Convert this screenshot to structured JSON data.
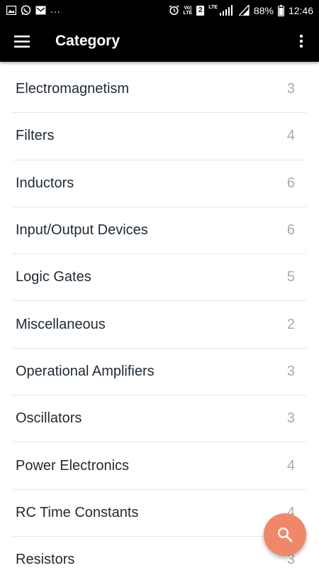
{
  "status_bar": {
    "left_icons": [
      "gallery-icon",
      "whatsapp-icon",
      "mail-icon"
    ],
    "overflow": "...",
    "vol_lte_top": "Vo)",
    "vol_lte_bottom": "LTE",
    "sim": "2",
    "lte": "LTE",
    "battery": "88%",
    "time": "12:46"
  },
  "app_bar": {
    "title": "Category",
    "menu_icon": "hamburger-menu-icon",
    "overflow_icon": "more-vert-icon"
  },
  "categories": [
    {
      "label": "Electromagnetism",
      "count": "3"
    },
    {
      "label": "Filters",
      "count": "4"
    },
    {
      "label": "Inductors",
      "count": "6"
    },
    {
      "label": "Input/Output Devices",
      "count": "6"
    },
    {
      "label": "Logic Gates",
      "count": "5"
    },
    {
      "label": "Miscellaneous",
      "count": "2"
    },
    {
      "label": "Operational Amplifiers",
      "count": "3"
    },
    {
      "label": "Oscillators",
      "count": "3"
    },
    {
      "label": "Power Electronics",
      "count": "4"
    },
    {
      "label": "RC Time Constants",
      "count": "4"
    },
    {
      "label": "Resistors",
      "count": "3"
    }
  ],
  "fab": {
    "icon": "search-icon",
    "color": "#f0876a"
  },
  "colors": {
    "app_bar": "#000000",
    "label_text": "#1f2a33",
    "count_text": "#a9a9a9",
    "divider": "#e6e6e6"
  }
}
